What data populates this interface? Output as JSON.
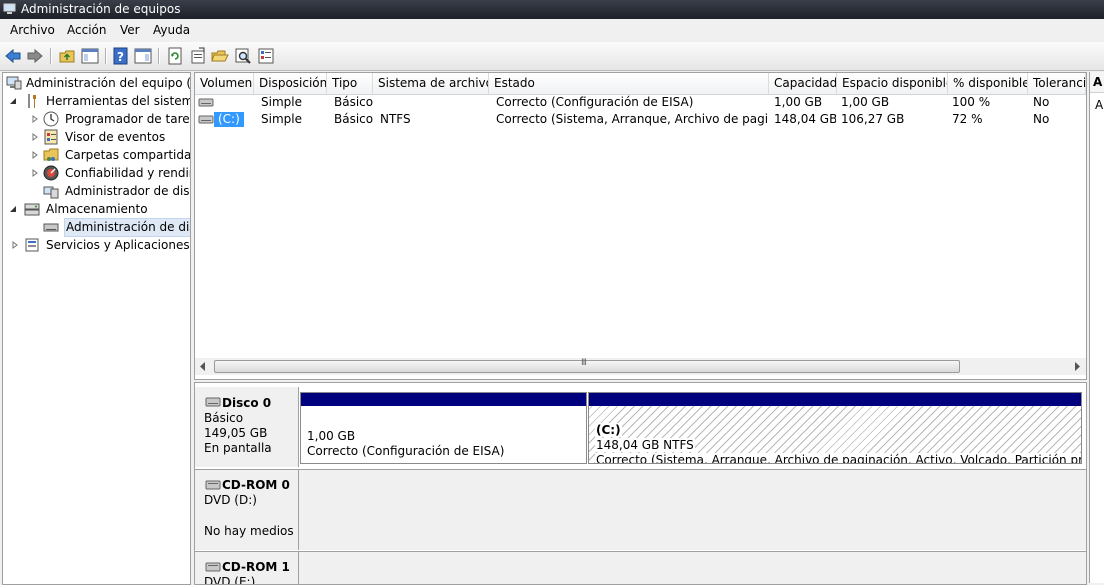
{
  "window": {
    "title": "Administración de equipos"
  },
  "menu": [
    "Archivo",
    "Acción",
    "Ver",
    "Ayuda"
  ],
  "tree": {
    "root": "Administración del equipo (loc",
    "items": [
      "Herramientas del sistema",
      "Programador de tareas",
      "Visor de eventos",
      "Carpetas compartidas",
      "Confiabilidad y rendimi",
      "Administrador de dispo",
      "Almacenamiento",
      "Administración de disco",
      "Servicios y Aplicaciones"
    ]
  },
  "volumes": {
    "columns": [
      "Volumen",
      "Disposición",
      "Tipo",
      "Sistema de archivos",
      "Estado",
      "Capacidad",
      "Espacio disponible",
      "% disponible",
      "Tolerancia"
    ],
    "rows": [
      [
        "",
        "Simple",
        "Básico",
        "",
        "Correcto (Configuración de EISA)",
        "1,00 GB",
        "1,00 GB",
        "100 %",
        "No"
      ],
      [
        "(C:)",
        "Simple",
        "Básico",
        "NTFS",
        "Correcto (Sistema, Arranque, Archivo de paginac...",
        "148,04 GB",
        "106,27 GB",
        "72 %",
        "No"
      ]
    ],
    "scroll_grip": "III"
  },
  "right_pane": {
    "header": "A",
    "row": "A"
  },
  "disks": [
    {
      "name": "Disco 0",
      "type": "Básico",
      "size": "149,05 GB",
      "status": "En pantalla",
      "partitions": [
        {
          "name": "",
          "size": "1,00 GB",
          "status": "Correcto (Configuración de EISA)"
        },
        {
          "name": "(C:)",
          "size": "148,04 GB NTFS",
          "status": "Correcto (Sistema, Arranque, Archivo de paginación, Activo, Volcado, Partición primaria)"
        }
      ]
    },
    {
      "name": "CD-ROM 0",
      "type": "DVD (D:)",
      "status": "No hay medios"
    },
    {
      "name": "CD-ROM 1",
      "type": "DVD (E:)"
    }
  ],
  "colors": {
    "partition_bar": "#00007f",
    "selection": "#3399ff"
  }
}
